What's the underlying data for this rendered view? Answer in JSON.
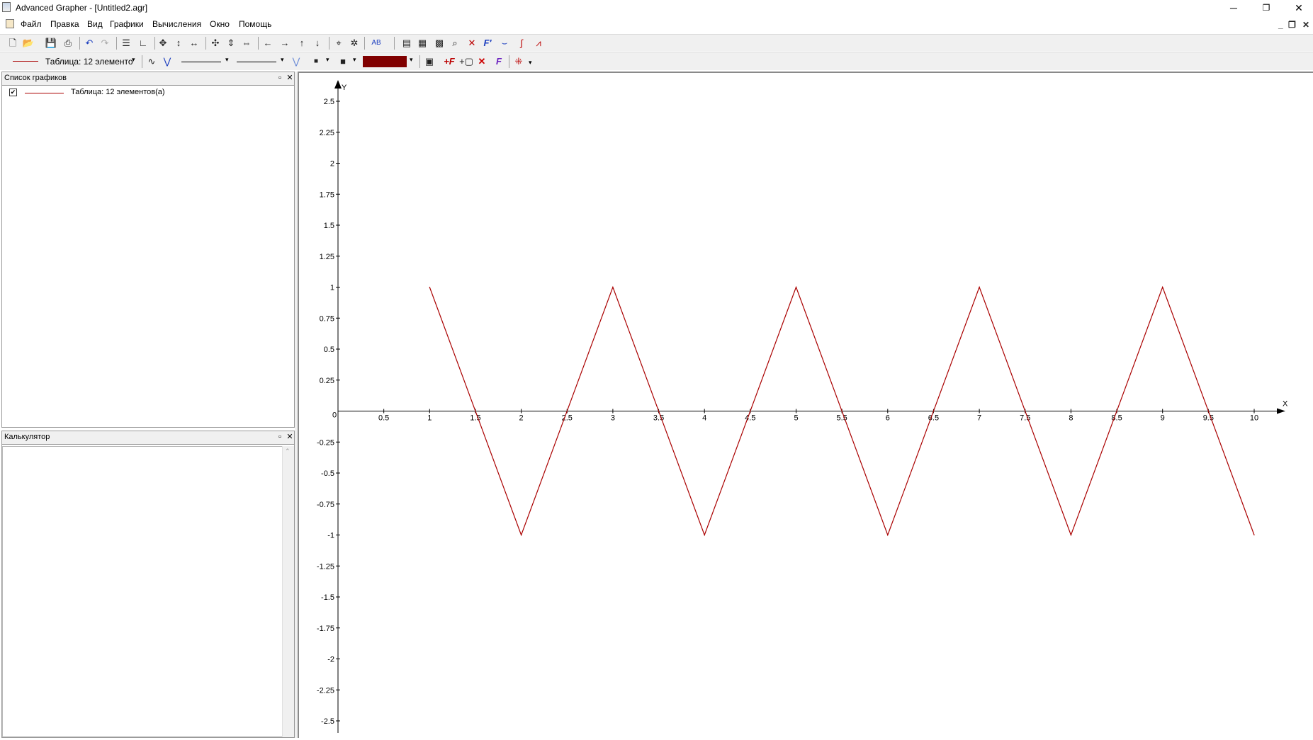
{
  "window": {
    "title": "Advanced Grapher - [Untitled2.agr]",
    "minimize_label": "─",
    "restore_label": "❐",
    "close_label": "✕"
  },
  "menu": {
    "items": [
      "Файл",
      "Правка",
      "Вид",
      "Графики",
      "Вычисления",
      "Окно",
      "Помощь"
    ]
  },
  "mdi_controls": [
    "_",
    "❐",
    "✕"
  ],
  "toolbar1": {
    "buttons": [
      "new-file-icon",
      "open-file-icon",
      "save-icon",
      "print-icon",
      "undo-icon",
      "redo-icon",
      "graph-list-icon",
      "axes-icon",
      "move-all-icon",
      "move-vertical-icon",
      "move-horizontal-icon",
      "zoom-in-icon",
      "zoom-in-vertical-icon",
      "zoom-in-horizontal-icon",
      "arrow-left-icon",
      "arrow-right-icon",
      "arrow-up-icon",
      "arrow-down-icon",
      "center-icon",
      "coordinates-icon",
      "text-label-icon",
      "window-icon",
      "calculator-icon",
      "table-icon",
      "trace-icon",
      "intersection-icon",
      "derivative-icon",
      "tangent-icon",
      "integral-icon",
      "chart-options-icon"
    ],
    "text_label": "AB"
  },
  "toolbar2": {
    "graph_selector": "Таблица: 12 элементо",
    "fill_color": "#800000"
  },
  "graph_list_panel": {
    "title": "Список графиков",
    "items": [
      {
        "checked": true,
        "color": "#aa0000",
        "label": "Таблица: 12 элементов(а)"
      }
    ]
  },
  "calculator_panel": {
    "title": "Калькулятор"
  },
  "chart_data": {
    "type": "line",
    "x_axis_label": "X",
    "y_axis_label": "Y",
    "xlim": [
      0,
      10
    ],
    "ylim": [
      -2.5,
      2.5
    ],
    "x_ticks": [
      0,
      0.5,
      1,
      1.5,
      2,
      2.5,
      3,
      3.5,
      4,
      4.5,
      5,
      5.5,
      6,
      6.5,
      7,
      7.5,
      8,
      8.5,
      9,
      9.5,
      10
    ],
    "y_ticks": [
      -2.5,
      -2.25,
      -2,
      -1.75,
      -1.5,
      -1.25,
      -1,
      -0.75,
      -0.5,
      -0.25,
      0.25,
      0.5,
      0.75,
      1,
      1.25,
      1.5,
      1.75,
      2,
      2.25,
      2.5
    ],
    "origin_label": "0",
    "series": [
      {
        "color": "#aa0000",
        "x": [
          1,
          2,
          3,
          4,
          5,
          6,
          7,
          8,
          9,
          10
        ],
        "y": [
          1,
          -1,
          1,
          -1,
          1,
          -1,
          1,
          -1,
          1,
          -1
        ]
      }
    ],
    "grid": false
  }
}
